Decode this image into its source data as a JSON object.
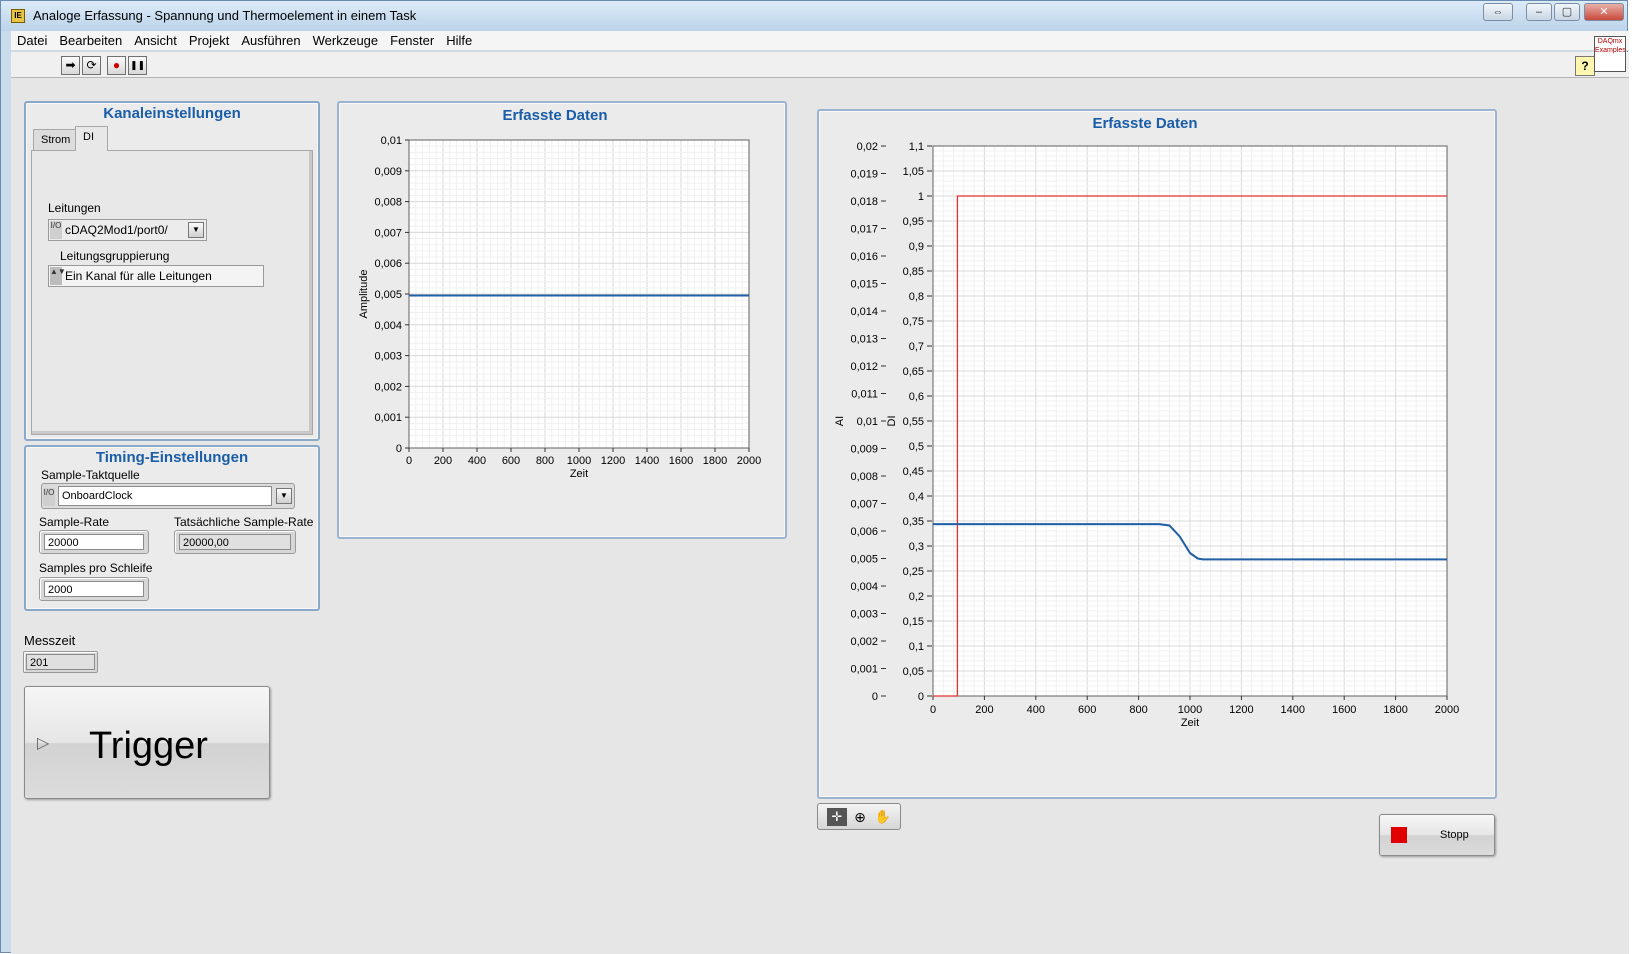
{
  "window": {
    "title": "Analoge Erfassung - Spannung und Thermoelement in einem Task",
    "app_icon": "IE",
    "controls": [
      "⇔",
      "–",
      "▢",
      "✕"
    ]
  },
  "menu": [
    "Datei",
    "Bearbeiten",
    "Ansicht",
    "Projekt",
    "Ausführen",
    "Werkzeuge",
    "Fenster",
    "Hilfe"
  ],
  "toolbar": {
    "run_icon": "➡",
    "run_continuous_icon": "⟳",
    "abort_icon": "●",
    "pause_icon": "❚❚",
    "help_icon": "?",
    "logo_text": "DAQmx Examples"
  },
  "channel_settings": {
    "title": "Kanaleinstellungen",
    "tabs": [
      "Strom",
      "DI"
    ],
    "lines_label": "Leitungen",
    "lines_value": "cDAQ2Mod1/port0/",
    "grouping_label": "Leitungsgruppierung",
    "grouping_value": "Ein Kanal für alle Leitungen"
  },
  "timing": {
    "title": "Timing-Einstellungen",
    "clock_label": "Sample-Taktquelle",
    "clock_value": "OnboardClock",
    "rate_label": "Sample-Rate",
    "rate_value": "20000",
    "actual_rate_label": "Tatsächliche Sample-Rate",
    "actual_rate_value": "20000,00",
    "samples_label": "Samples pro Schleife",
    "samples_value": "2000"
  },
  "measure_time": {
    "label": "Messzeit",
    "value": "201"
  },
  "trigger_button": {
    "label": "Trigger"
  },
  "stop_button": {
    "label": "Stopp"
  },
  "palette": {
    "cursor_icon": "✛",
    "zoom_icon": "⊕",
    "pan_icon": "✋"
  },
  "colors": {
    "title_blue": "#1a5da8",
    "series_blue": "#1f5fa5",
    "series_red": "#e23232",
    "stop_red": "#e00000"
  },
  "chart_data": [
    {
      "type": "line",
      "title": "Erfasste Daten",
      "xlabel": "Zeit",
      "ylabel": "Amplitude",
      "xlim": [
        0,
        2000
      ],
      "ylim": [
        0,
        0.01
      ],
      "x_ticks": [
        "0",
        "200",
        "400",
        "600",
        "800",
        "1000",
        "1200",
        "1400",
        "1600",
        "1800",
        "2000"
      ],
      "y_ticks": [
        "0",
        "0,001",
        "0,002",
        "0,003",
        "0,004",
        "0,005",
        "0,006",
        "0,007",
        "0,008",
        "0,009",
        "0,01"
      ],
      "grid": true,
      "series": [
        {
          "x": [
            0,
            2000
          ],
          "y": [
            0.00495,
            0.00495
          ]
        }
      ]
    },
    {
      "type": "line",
      "title": "Erfasste Daten",
      "xlabel": "Zeit",
      "ylabel_left": "AI",
      "ylabel_right": "DI",
      "xlim": [
        0,
        2000
      ],
      "ylim_ai": [
        0,
        0.02
      ],
      "ylim_di": [
        0,
        1.1
      ],
      "x_ticks": [
        "0",
        "200",
        "400",
        "600",
        "800",
        "1000",
        "1200",
        "1400",
        "1600",
        "1800",
        "2000"
      ],
      "ai_ticks": [
        "0",
        "0,001",
        "0,002",
        "0,003",
        "0,004",
        "0,005",
        "0,006",
        "0,007",
        "0,008",
        "0,009",
        "0,01",
        "0,011",
        "0,012",
        "0,013",
        "0,014",
        "0,015",
        "0,016",
        "0,017",
        "0,018",
        "0,019",
        "0,02"
      ],
      "di_ticks": [
        "0",
        "0,05",
        "0,1",
        "0,15",
        "0,2",
        "0,25",
        "0,3",
        "0,35",
        "0,4",
        "0,45",
        "0,5",
        "0,55",
        "0,6",
        "0,65",
        "0,7",
        "0,75",
        "0,8",
        "0,85",
        "0,9",
        "0,95",
        "1",
        "1,05",
        "1,1"
      ],
      "grid": true,
      "series": [
        {
          "axis": "DI",
          "color": "#e23232",
          "x": [
            0,
            95,
            95,
            2000
          ],
          "y": [
            0,
            0,
            1,
            1
          ]
        },
        {
          "axis": "AI",
          "color": "#1f5fa5",
          "x": [
            0,
            880,
            920,
            960,
            1000,
            1030,
            1050,
            2000
          ],
          "y": [
            0.00625,
            0.00625,
            0.0062,
            0.0058,
            0.0052,
            0.005,
            0.00497,
            0.00497
          ]
        }
      ]
    }
  ]
}
